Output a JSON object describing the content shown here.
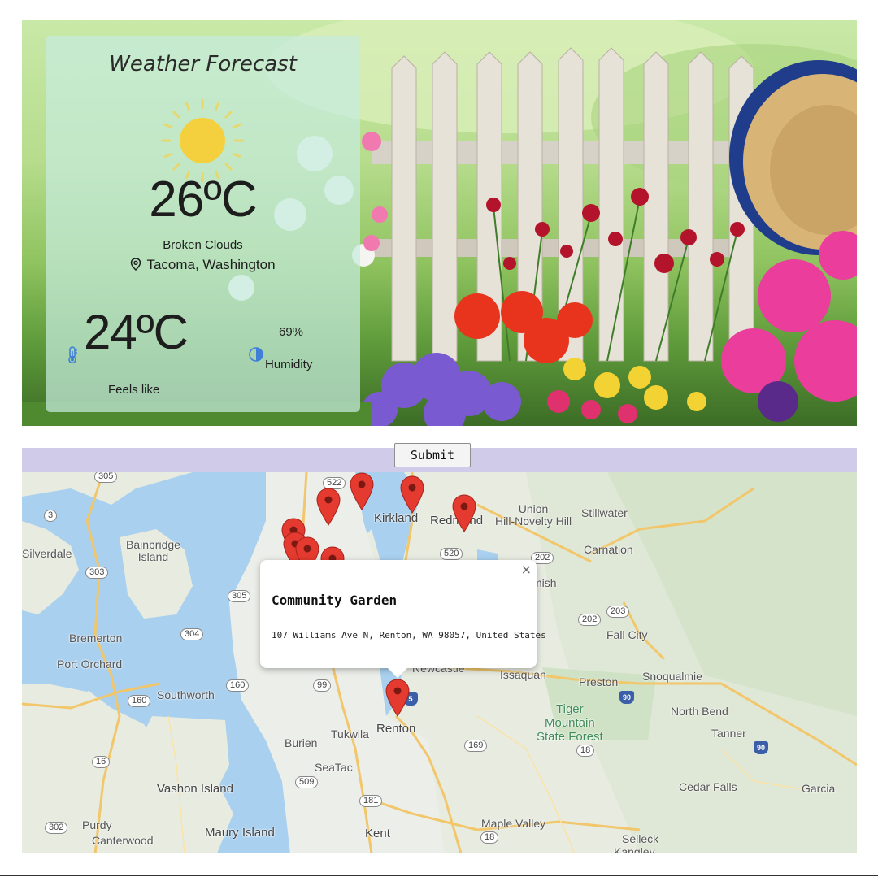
{
  "weather": {
    "title": "Weather Forecast",
    "temperature": "26ºC",
    "condition": "Broken Clouds",
    "location": "Tacoma, Washington",
    "feels_like_value": "24ºC",
    "feels_like_label": "Feels like",
    "humidity_value": "69%",
    "humidity_label": "Humidity"
  },
  "form": {
    "submit_label": "Submit"
  },
  "map": {
    "places": {
      "silverdale": "Silverdale",
      "bainbridge": "Bainbridge\nIsland",
      "bremerton": "Bremerton",
      "port_orchard": "Port Orchard",
      "southworth": "Southworth",
      "vashon": "Vashon Island",
      "maury": "Maury Island",
      "purdy": "Purdy",
      "canterwood": "Canterwood",
      "kirkland": "Kirkland",
      "redmond": "Redmond",
      "union_hill": "Union\nHill-Novelty Hill",
      "stillwater": "Stillwater",
      "carnation": "Carnation",
      "fall_city": "Fall City",
      "issaquah": "Issaquah",
      "preston": "Preston",
      "snoqualmie": "Snoqualmie",
      "north_bend": "North Bend",
      "tanner": "Tanner",
      "tiger": "Tiger\nMountain\nState Forest",
      "renton": "Renton",
      "tukwila": "Tukwila",
      "burien": "Burien",
      "seatac": "SeaTac",
      "kent": "Kent",
      "maple_valley": "Maple Valley",
      "cedar_falls": "Cedar Falls",
      "garcia": "Garcia",
      "selleck": "Selleck",
      "kangley": "Kangley",
      "newcastle": "Newcastle",
      "mish": "mish"
    },
    "shields": [
      "305",
      "3",
      "303",
      "305",
      "304",
      "160",
      "160",
      "16",
      "302",
      "509",
      "181",
      "99",
      "522",
      "520",
      "202",
      "203",
      "202",
      "169",
      "18",
      "18"
    ],
    "interstates": [
      "5",
      "90",
      "90"
    ],
    "popup": {
      "title": "Community Garden",
      "address": "107 Williams Ave N, Renton, WA 98057, United States",
      "close": "×"
    }
  },
  "colors": {
    "marker": "#e53a2f",
    "form_bar": "#cfcbe8",
    "water": "#a8cff0",
    "land": "#e8eae3"
  }
}
